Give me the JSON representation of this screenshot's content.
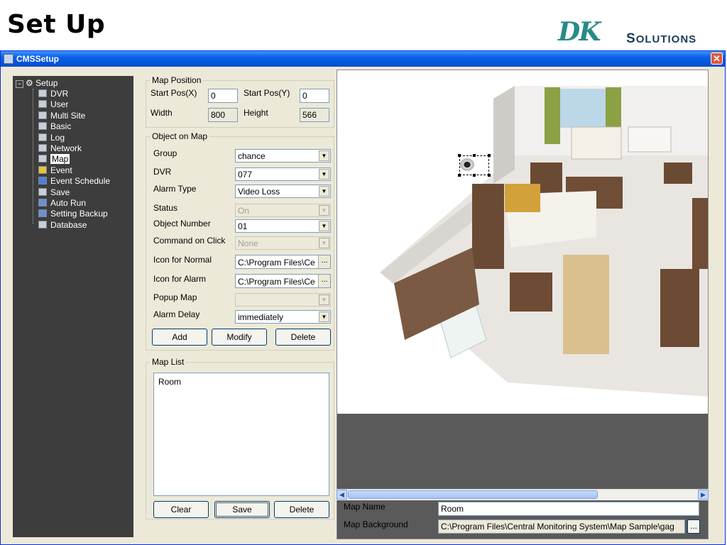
{
  "slide": {
    "title": "Set Up",
    "logo_mark": "DK",
    "logo_text_first": "S",
    "logo_text_rest": "OLUTIONS"
  },
  "window": {
    "title": "CMSSetup",
    "close": "✕"
  },
  "tree": {
    "root": "Setup",
    "items": [
      {
        "label": "DVR",
        "icon": "dvr-icon"
      },
      {
        "label": "User",
        "icon": "user-icon"
      },
      {
        "label": "Multi Site",
        "icon": "multi-site-icon"
      },
      {
        "label": "Basic",
        "icon": "basic-icon"
      },
      {
        "label": "Log",
        "icon": "log-icon"
      },
      {
        "label": "Network",
        "icon": "network-icon"
      },
      {
        "label": "Map",
        "icon": "map-icon"
      },
      {
        "label": "Event",
        "icon": "event-icon"
      },
      {
        "label": "Event Schedule",
        "icon": "event-schedule-icon"
      },
      {
        "label": "Save",
        "icon": "save-icon"
      },
      {
        "label": "Auto Run",
        "icon": "auto-run-icon"
      },
      {
        "label": "Setting Backup",
        "icon": "setting-backup-icon"
      },
      {
        "label": "Database",
        "icon": "database-icon"
      }
    ],
    "selected": "Map"
  },
  "map_position": {
    "group_label": "Map Position",
    "start_x_label": "Start Pos(X)",
    "start_x": "0",
    "start_y_label": "Start Pos(Y)",
    "start_y": "0",
    "width_label": "Width",
    "width": "800",
    "height_label": "Height",
    "height": "566"
  },
  "object_on_map": {
    "group_label": "Object on Map",
    "group": {
      "label": "Group",
      "value": "chance"
    },
    "dvr": {
      "label": "DVR",
      "value": "077"
    },
    "alarm_type": {
      "label": "Alarm Type",
      "value": "Video Loss"
    },
    "status": {
      "label": "Status",
      "value": "On"
    },
    "object_number": {
      "label": "Object Number",
      "value": "01"
    },
    "command_on_click": {
      "label": "Command on Click",
      "value": "None"
    },
    "icon_normal": {
      "label": "Icon for Normal",
      "value": "C:\\Program Files\\Ce"
    },
    "icon_alarm": {
      "label": "Icon for Alarm",
      "value": "C:\\Program Files\\Ce"
    },
    "popup_map": {
      "label": "Popup Map",
      "value": ""
    },
    "alarm_delay": {
      "label": "Alarm Delay",
      "value": "immediately"
    },
    "add": "Add",
    "modify": "Modify",
    "delete": "Delete",
    "browse": "..."
  },
  "map_list": {
    "group_label": "Map List",
    "items": [
      "Room"
    ],
    "clear": "Clear",
    "save": "Save",
    "delete": "Delete"
  },
  "map_footer": {
    "name_label": "Map Name",
    "name": "Room",
    "background_label": "Map Background",
    "background": "C:\\Program Files\\Central Monitoring System\\Map Sample\\gag",
    "browse": "..."
  },
  "colors": {
    "tree_bg": "#3d3d3d",
    "window_bg": "#ece9d8",
    "titlebar": "#0a5fe6",
    "logo_teal": "#2a8a86"
  }
}
